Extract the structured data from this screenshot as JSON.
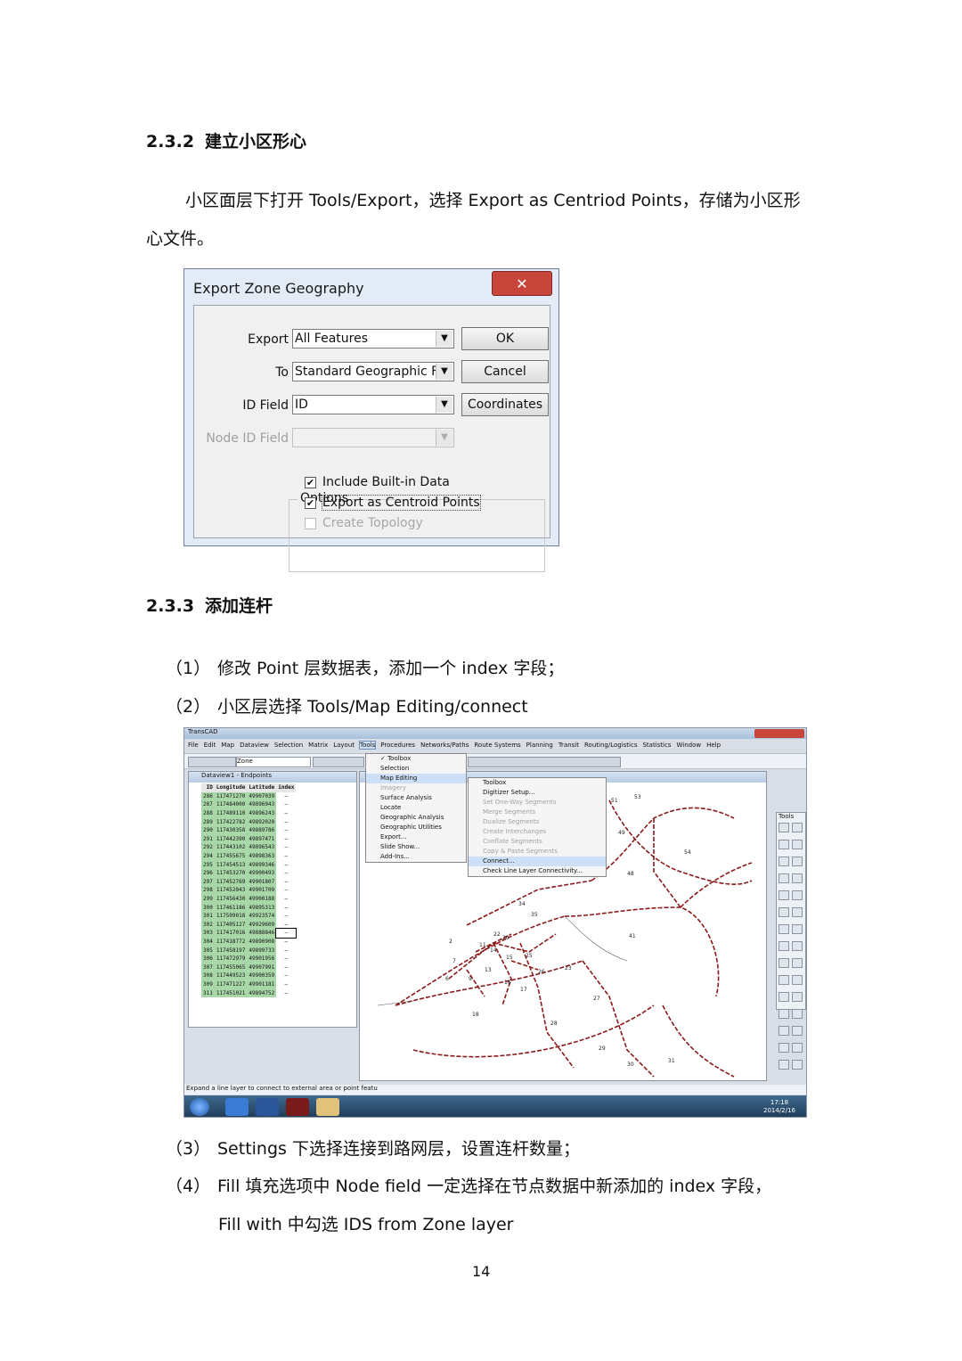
{
  "section_232": {
    "num": "2.3.2",
    "title": "建立小区形心"
  },
  "para_232": {
    "line1": "小区面层下打开 Tools/Export，选择 Export as Centriod Points，存储为小区形",
    "line2": "心文件。"
  },
  "dialog": {
    "title": "Export Zone Geography",
    "close_glyph": "✕",
    "export_label": "Export",
    "export_value": "All Features",
    "to_label": "To",
    "to_value": "Standard Geographic Fi",
    "id_field_label": "ID Field",
    "id_field_value": "ID",
    "node_id_label": "Node ID Field",
    "ok": "OK",
    "cancel": "Cancel",
    "coordinates": "Coordinates",
    "options_title": "Options",
    "opt1": "Include Built-in Data",
    "opt2": "Export as Centroid Points",
    "opt3": "Create Topology",
    "check_glyph": "✔"
  },
  "section_233": {
    "num": "2.3.3",
    "title": "添加连杆"
  },
  "steps": [
    {
      "mark": "（1）",
      "text": "修改 Point 层数据表，添加一个 index 字段；"
    },
    {
      "mark": "（2）",
      "text": "小区层选择 Tools/Map Editing/connect"
    },
    {
      "mark": "（3）",
      "text": "Settings 下选择连接到路网层，设置连杆数量；"
    },
    {
      "mark": "（4）",
      "text": "Fill 填充选项中 Node field 一定选择在节点数据中新添加的 index 字段，"
    }
  ],
  "step4_cont": "Fill with 中勾选 IDS from Zone layer",
  "page_number": "14",
  "transcad": {
    "title": "TransCAD",
    "menubar": [
      "File",
      "Edit",
      "Map",
      "Dataview",
      "Selection",
      "Matrix",
      "Layout",
      "Tools",
      "Procedures",
      "Networks/Paths",
      "Route Systems",
      "Planning",
      "Transit",
      "Routing/Logistics",
      "Statistics",
      "Window",
      "Help"
    ],
    "layer_combo": "Zone",
    "dataview_title": "Dataview1 - Endpoints",
    "columns": [
      "ID",
      "Longitude",
      "Latitude",
      "index"
    ],
    "rows": [
      [
        "286",
        "117471270",
        "49907039"
      ],
      [
        "287",
        "117484000",
        "49896943"
      ],
      [
        "288",
        "117489110",
        "49896243"
      ],
      [
        "289",
        "117422782",
        "49892020"
      ],
      [
        "290",
        "117430358",
        "49889786"
      ],
      [
        "291",
        "117442390",
        "49897471"
      ],
      [
        "292",
        "117443102",
        "49896543"
      ],
      [
        "294",
        "117455675",
        "49898363"
      ],
      [
        "295",
        "117454513",
        "49899346"
      ],
      [
        "296",
        "117453270",
        "49900493"
      ],
      [
        "297",
        "117452769",
        "49901807"
      ],
      [
        "298",
        "117452043",
        "49901709"
      ],
      [
        "299",
        "117456430",
        "49900188"
      ],
      [
        "300",
        "117461186",
        "49895313"
      ],
      [
        "301",
        "117509018",
        "49923574"
      ],
      [
        "302",
        "117405127",
        "49929609"
      ],
      [
        "303",
        "117417016",
        "49888846"
      ],
      [
        "304",
        "117418772",
        "49890908"
      ],
      [
        "305",
        "117458197",
        "49899733"
      ],
      [
        "306",
        "117472979",
        "49901956"
      ],
      [
        "307",
        "117455065",
        "49907991"
      ],
      [
        "308",
        "117449523",
        "49900359"
      ],
      [
        "309",
        "117471227",
        "49901181"
      ],
      [
        "311",
        "117451021",
        "49894752"
      ]
    ],
    "tools_menu": [
      {
        "label": "✓ Toolbox",
        "state": "normal"
      },
      {
        "label": "Selection",
        "state": "normal"
      },
      {
        "label": "Map Editing",
        "state": "hl"
      },
      {
        "label": "Imagery",
        "state": "dis"
      },
      {
        "label": "Surface Analysis",
        "state": "normal"
      },
      {
        "label": "Locate",
        "state": "normal"
      },
      {
        "label": "Geographic Analysis",
        "state": "normal"
      },
      {
        "label": "Geographic Utilities",
        "state": "normal"
      },
      {
        "label": "Export...",
        "state": "normal"
      },
      {
        "label": "Slide Show...",
        "state": "normal"
      },
      {
        "label": "Add-Ins...",
        "state": "normal"
      }
    ],
    "map_editing_menu": [
      {
        "label": "Toolbox",
        "state": "normal"
      },
      {
        "label": "Digitizer Setup...",
        "state": "normal"
      },
      {
        "label": "Set One-Way Segments",
        "state": "dis"
      },
      {
        "label": "Merge Segments",
        "state": "dis"
      },
      {
        "label": "Dualize Segments",
        "state": "dis"
      },
      {
        "label": "Create Interchanges",
        "state": "dis"
      },
      {
        "label": "Conflate Segments",
        "state": "dis"
      },
      {
        "label": "Copy & Paste Segments",
        "state": "dis"
      },
      {
        "label": "Connect...",
        "state": "hl"
      },
      {
        "label": "Check Line Layer Connectivity...",
        "state": "normal"
      }
    ],
    "zone_labels": [
      "51",
      "53",
      "49",
      "54",
      "48",
      "34",
      "35",
      "41",
      "2",
      "22",
      "20",
      "11",
      "14",
      "7",
      "15",
      "25",
      "26",
      "9",
      "13",
      "6",
      "16",
      "17",
      "23",
      "27",
      "18",
      "28",
      "29",
      "30",
      "31"
    ],
    "tools_palette_title": "Tools",
    "status_text": "Expand a line layer to connect to external area or point featu",
    "clock_time": "17:18",
    "clock_date": "2014/2/16",
    "colors": {
      "road": "#8b1a1a",
      "dataview_green": "#a8d8a8",
      "menu_highlight": "#cde0f7"
    }
  }
}
